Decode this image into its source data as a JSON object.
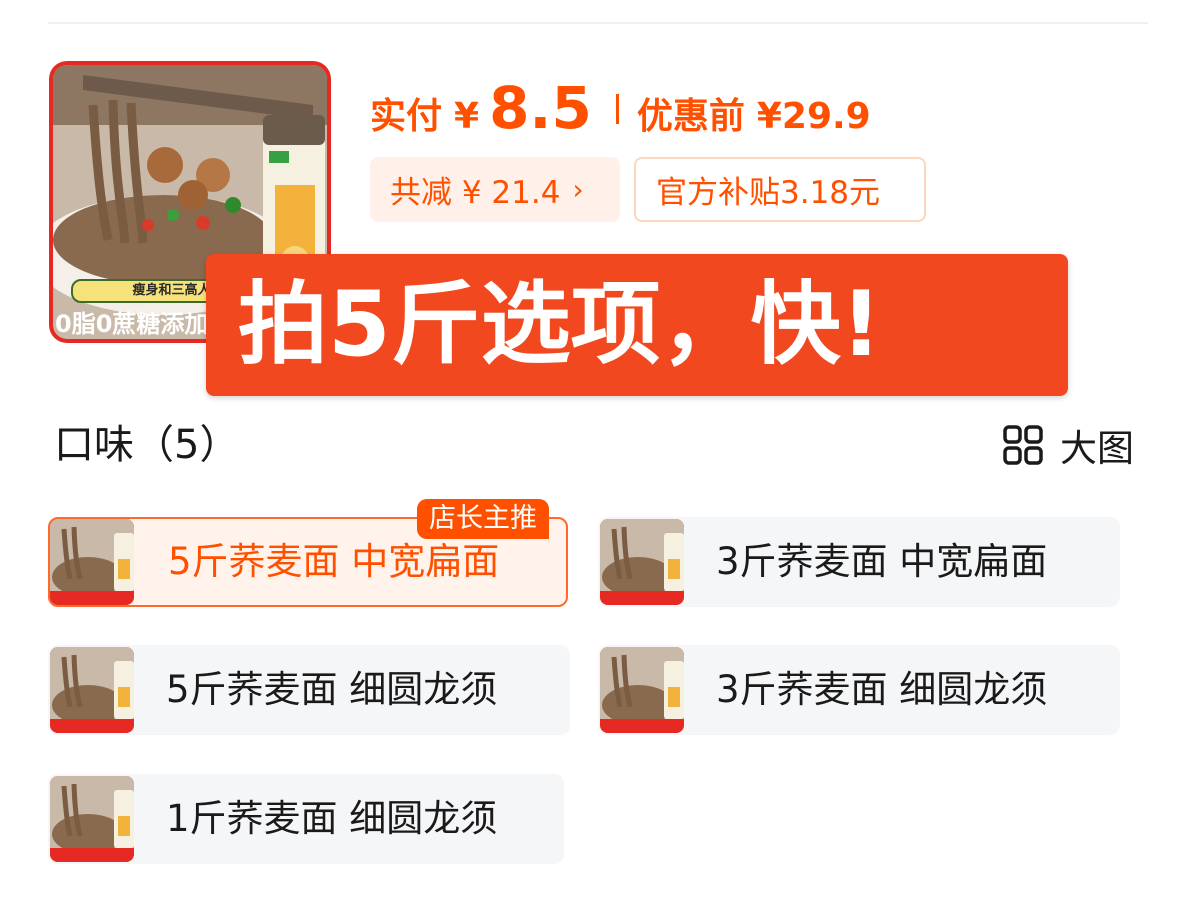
{
  "product": {
    "image_caption": "0脂0蔗糖添加",
    "image_strip": "瘦身和三高人群"
  },
  "price": {
    "pay_label": "实付",
    "currency": "¥",
    "pay_amount": "8.5",
    "original_label": "优惠前",
    "original_price": "¥29.9"
  },
  "chips": {
    "total_discount": "共减 ¥ 21.4",
    "chevron": "›",
    "subsidy": "官方补贴3.18元"
  },
  "overlay": {
    "text": "拍5斤选项，快!"
  },
  "section": {
    "title": "口味（5）",
    "view_label": "大图"
  },
  "badge": {
    "label": "店长主推"
  },
  "options": [
    {
      "label": "5斤荞麦面 中宽扁面",
      "selected": true
    },
    {
      "label": "3斤荞麦面 中宽扁面",
      "selected": false
    },
    {
      "label": "5斤荞麦面 细圆龙须",
      "selected": false
    },
    {
      "label": "3斤荞麦面 细圆龙须",
      "selected": false
    },
    {
      "label": "1斤荞麦面 细圆龙须",
      "selected": false
    }
  ],
  "colors": {
    "accent": "#ff5000",
    "banner": "#f1481f",
    "image_frame": "#e62a23"
  }
}
